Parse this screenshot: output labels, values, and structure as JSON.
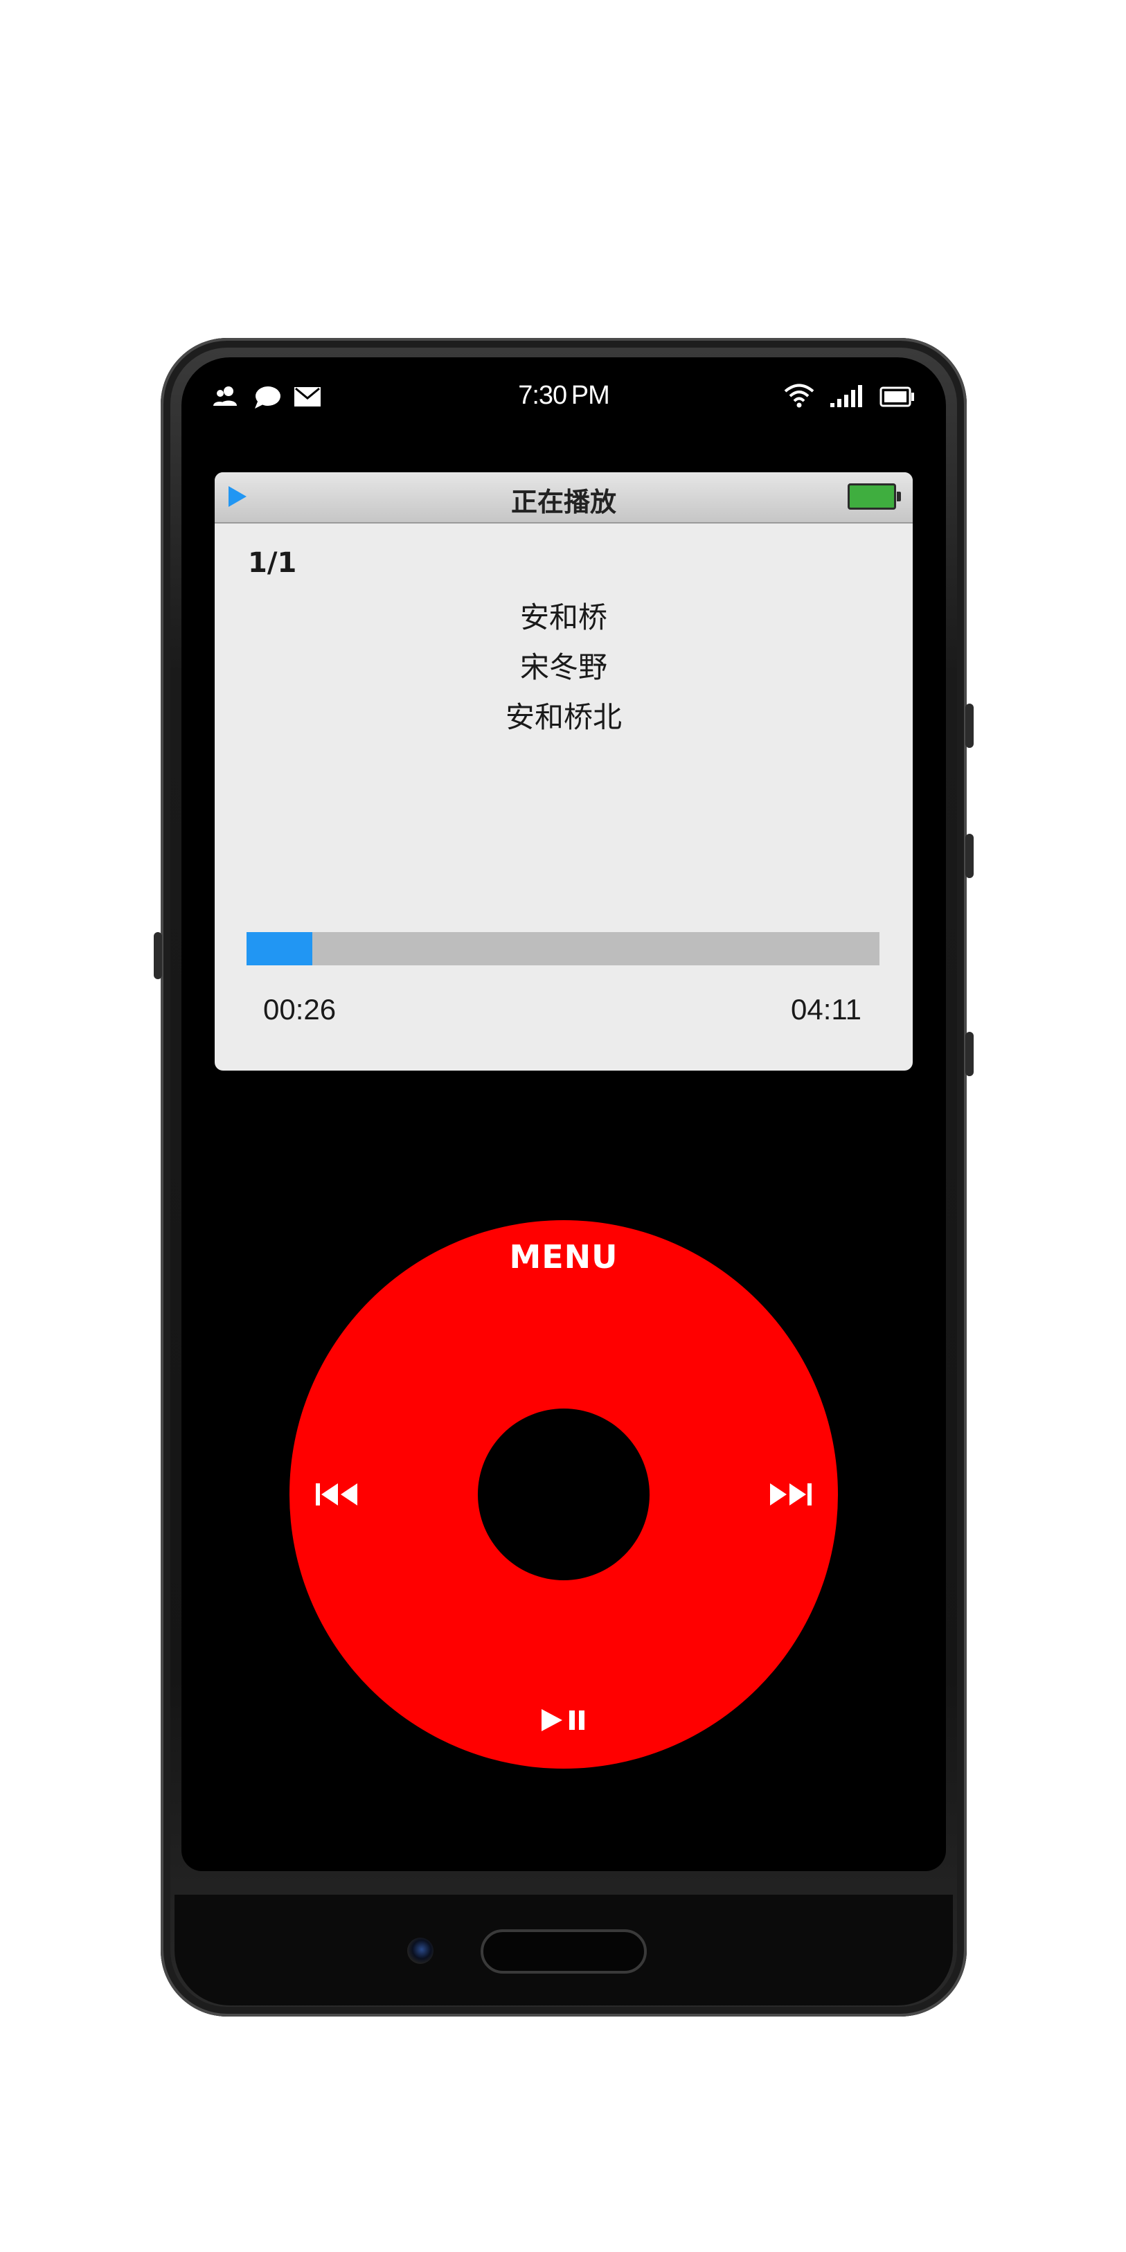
{
  "status_bar": {
    "time": "7:30 PM",
    "left_icons": [
      "contacts-icon",
      "chat-icon",
      "mail-icon"
    ],
    "right_icons": [
      "wifi-icon",
      "signal-icon",
      "battery-icon"
    ]
  },
  "player": {
    "header_title": "正在播放",
    "play_indicator_icon": "play-triangle-icon",
    "battery_color": "#3fae3f",
    "track_count": "1/1",
    "track_lines": [
      "安和桥",
      "宋冬野",
      "安和桥北"
    ],
    "elapsed": "00:26",
    "duration": "04:11",
    "progress_fraction": 0.104,
    "progress_color": "#2196f3"
  },
  "wheel": {
    "menu_label": "MENU",
    "color": "#ff0000",
    "prev_icon": "previous-track-icon",
    "next_icon": "next-track-icon",
    "play_pause_icon": "play-pause-icon"
  }
}
